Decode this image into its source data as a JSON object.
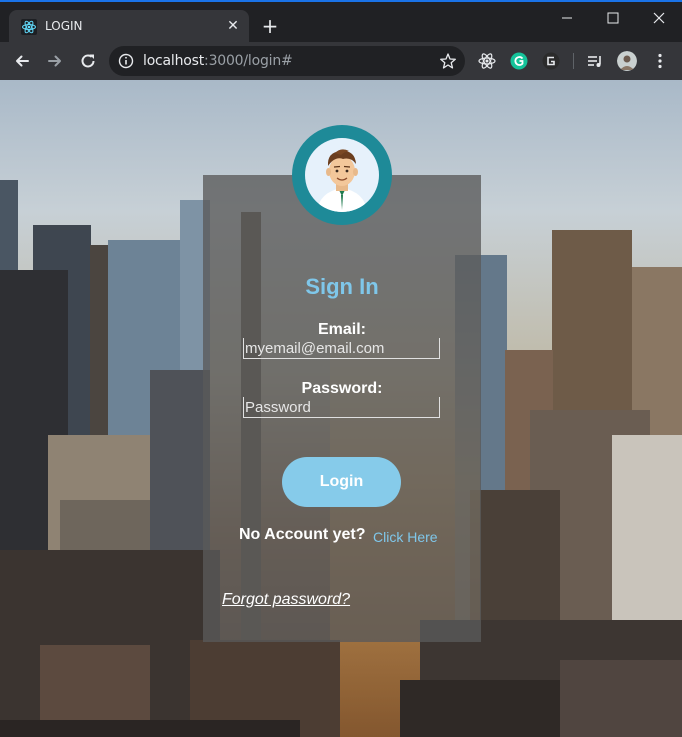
{
  "browser": {
    "tab_title": "LOGIN",
    "tab_close": "✕",
    "new_tab": "+",
    "url_host": "localhost",
    "url_path": ":3000/login#",
    "accent": "#1a73e8"
  },
  "login_form": {
    "title": "Sign In",
    "email_label": "Email:",
    "email_placeholder": "myemail@email.com",
    "password_label": "Password:",
    "password_placeholder": "Password",
    "login_button": "Login",
    "no_account_text": "No Account yet?",
    "click_here_link": "Click Here",
    "forgot_password_link": "Forgot password?"
  },
  "colors": {
    "title_color": "#7fc7ea",
    "button_color": "#86cbea",
    "avatar_ring": "#1e8a98",
    "card_overlay": "rgba(90,90,90,0.78)"
  }
}
